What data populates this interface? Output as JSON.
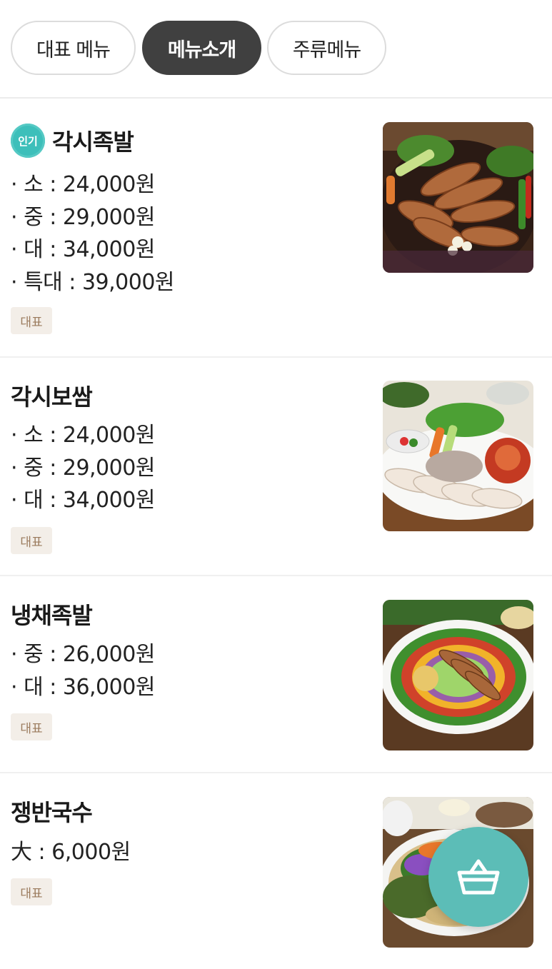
{
  "tabs": [
    {
      "label": "대표 메뉴",
      "active": false
    },
    {
      "label": "메뉴소개",
      "active": true
    },
    {
      "label": "주류메뉴",
      "active": false
    }
  ],
  "menu": [
    {
      "popular_badge": "인기",
      "name": "각시족발",
      "prices": [
        "· 소 : 24,000원",
        "· 중 : 29,000원",
        "· 대 : 34,000원",
        "· 특대 : 39,000원"
      ],
      "tag": "대표"
    },
    {
      "name": "각시보쌈",
      "prices": [
        "· 소 : 24,000원",
        "· 중 : 29,000원",
        "· 대 : 34,000원"
      ],
      "tag": "대표"
    },
    {
      "name": "냉채족발",
      "prices": [
        "· 중 : 26,000원",
        "· 대 : 36,000원"
      ],
      "tag": "대표"
    },
    {
      "name": "쟁반국수",
      "prices": [
        "大 : 6,000원"
      ],
      "tag": "대표"
    }
  ],
  "cart_button": {
    "icon": "basket-icon",
    "color": "#5cbdb7"
  },
  "colors": {
    "accent": "#3dbfba",
    "active_tab": "#404040",
    "tag_bg": "#f3eee8",
    "tag_text": "#9a7a5c"
  }
}
